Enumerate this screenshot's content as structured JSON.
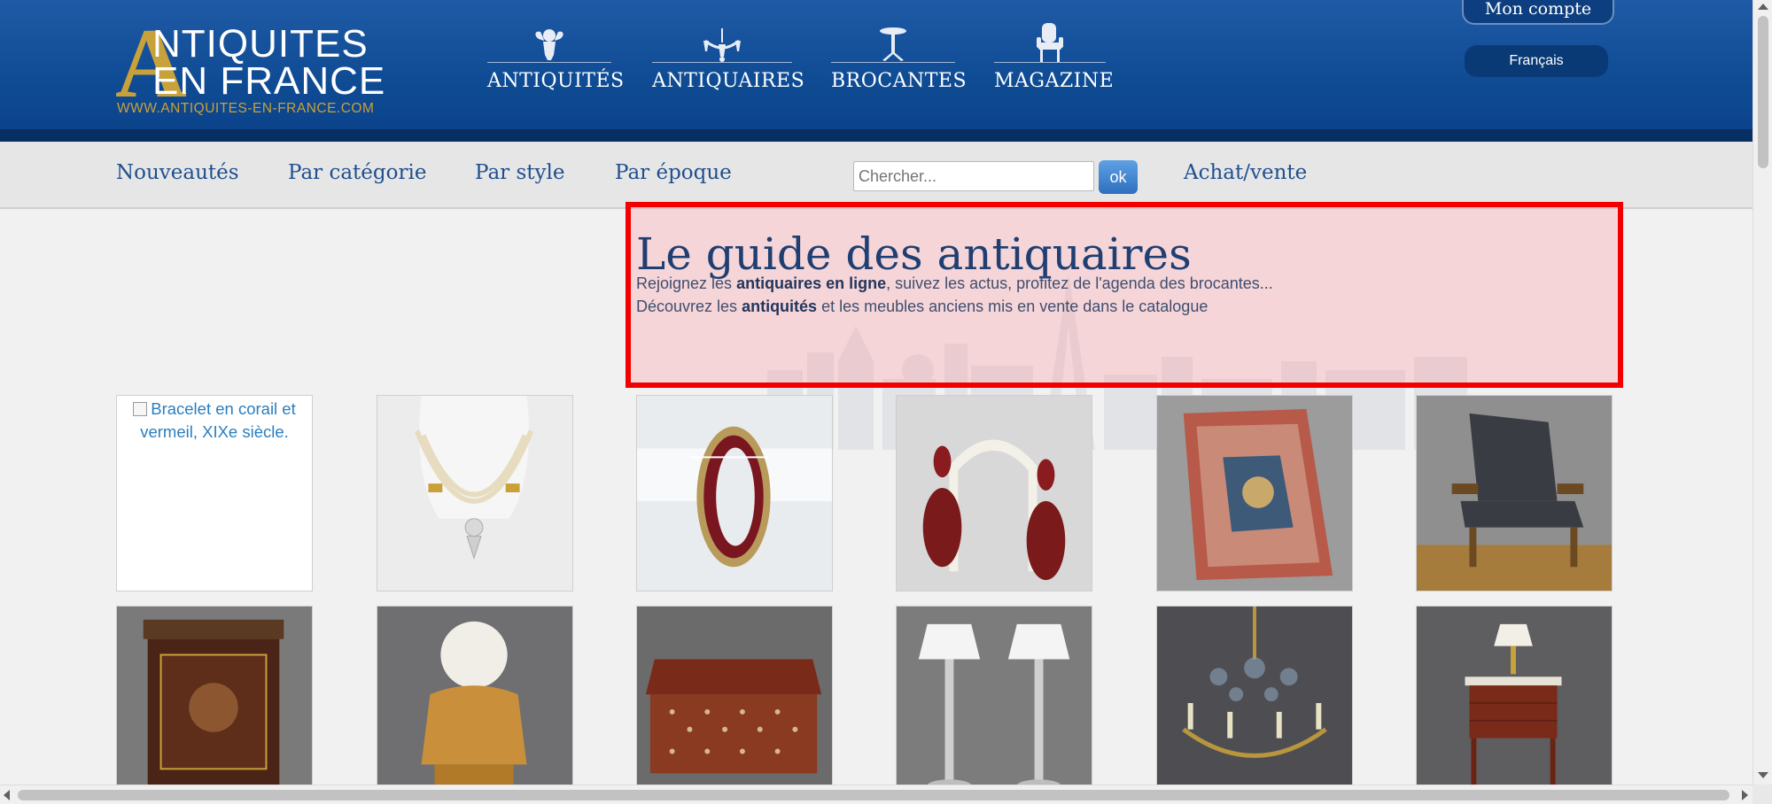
{
  "header": {
    "logo_initial": "A",
    "logo_line1": "NTIQUITES",
    "logo_line2": "EN FRANCE",
    "logo_url": "WWW.ANTIQUITES-EN-FRANCE.COM",
    "nav": [
      {
        "label": "ANTIQUITÉS",
        "icon": "cherub-icon"
      },
      {
        "label": "ANTIQUAIRES",
        "icon": "chandelier-icon"
      },
      {
        "label": "BROCANTES",
        "icon": "pedestal-table-icon"
      },
      {
        "label": "MAGAZINE",
        "icon": "armchair-icon"
      }
    ],
    "account_label": "Mon compte",
    "language_label": "Français"
  },
  "subnav": {
    "links": [
      "Nouveautés",
      "Par catégorie",
      "Par style",
      "Par époque"
    ],
    "search_placeholder": "Chercher...",
    "search_button": "ok",
    "buy_sell": "Achat/vente"
  },
  "hero": {
    "title": "Le guide des antiquaires",
    "line1_pre": "Rejoignez les ",
    "line1_bold": "antiquaires en ligne",
    "line1_post": ", suivez les actus, profitez de l'agenda des brocantes...",
    "line2_pre": "Découvrez les ",
    "line2_bold": "antiquités",
    "line2_post": " et les meubles anciens mis en vente dans le catalogue"
  },
  "products": [
    {
      "name": "bracelet",
      "alt": "Bracelet en corail et vermeil, XIXe siècle."
    },
    {
      "name": "pearl-necklace"
    },
    {
      "name": "garnet-ring"
    },
    {
      "name": "garnet-earrings"
    },
    {
      "name": "persian-rug"
    },
    {
      "name": "armchair"
    },
    {
      "name": "marquetry-cabinet"
    },
    {
      "name": "bronze-bust"
    },
    {
      "name": "inlaid-box"
    },
    {
      "name": "pair-of-lamps"
    },
    {
      "name": "crystal-chandelier"
    },
    {
      "name": "bedside-table-lamp"
    }
  ],
  "colors": {
    "header_blue": "#0e4b93",
    "gold": "#c9a13a",
    "link_blue": "#1f4f8f",
    "highlight_red": "#f20000"
  }
}
